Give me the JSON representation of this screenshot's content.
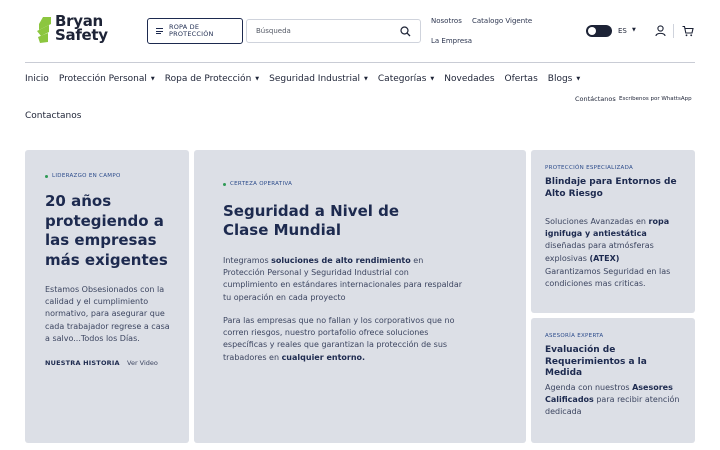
{
  "brand": {
    "line1": "Bryan",
    "line2": "Safety",
    "accent": "#8cc63f"
  },
  "header": {
    "category_button": "ROPA DE PROTECCIÓN",
    "search_placeholder": "Búsqueda",
    "links": {
      "nosotros": "Nosotros",
      "catalogo": "Catalogo Vigente",
      "empresa": "La Empresa"
    },
    "language": "ES"
  },
  "nav": {
    "items": [
      {
        "label": "Inicio",
        "dropdown": false
      },
      {
        "label": "Protección Personal",
        "dropdown": true
      },
      {
        "label": "Ropa de Protección",
        "dropdown": true
      },
      {
        "label": "Seguridad Industrial",
        "dropdown": true
      },
      {
        "label": "Categorías",
        "dropdown": true
      },
      {
        "label": "Novedades",
        "dropdown": false
      },
      {
        "label": "Ofertas",
        "dropdown": false
      },
      {
        "label": "Blogs",
        "dropdown": true
      }
    ],
    "contact_small": "Contáctanos",
    "whatsapp_small": "Escribenos por WhattsApp",
    "contact_second_row": "Contactanos"
  },
  "cards": {
    "liderazgo": {
      "eyebrow": "LIDERAZGO EN CAMPO",
      "title": "20 años protegiendo a las empresas más exigentes",
      "body": "Estamos Obsesionados con la calidad y el cumplimiento normativo, para asegurar que cada trabajador regrese a casa a salvo...Todos los Días.",
      "link_history": "NUESTRA HISTORIA",
      "link_video": "Ver Video"
    },
    "certeza": {
      "eyebrow": "CERTEZA OPERATIVA",
      "title": "Seguridad a Nivel de Clase Mundial",
      "p1_before": "Integramos ",
      "p1_bold": "soluciones de alto rendimiento",
      "p1_after": " en Protección Personal y Seguridad Industrial con cumplimiento en estándares internacionales para respaldar tu operación en cada proyecto",
      "p2_before": "Para las empresas que no fallan y los corporativos que no corren riesgos, nuestro portafolio ofrece soluciones específicas y reales que garantizan la protección de sus trabadores en ",
      "p2_bold": "cualquier entorno."
    },
    "proteccion": {
      "eyebrow": "PROTECCIÓN ESPECIALIZADA",
      "title": "Blindaje para Entornos de Alto Riesgo",
      "p1_before": "Soluciones Avanzadas en ",
      "p1_bold1": "ropa ignifuga y antiestática",
      "p1_mid": " diseñadas para atmósferas explosivas ",
      "p1_bold2": "(ATEX)",
      "p2": "Garantizamos Seguridad en las condiciones mas criticas."
    },
    "asesoria": {
      "eyebrow": "ASESORÍA EXPERTA",
      "title": "Evaluación de Requerimientos a la Medida",
      "body_before": "Agenda con nuestros ",
      "body_bold": "Asesores Calificados",
      "body_after": " para recibir atención dedicada"
    }
  }
}
